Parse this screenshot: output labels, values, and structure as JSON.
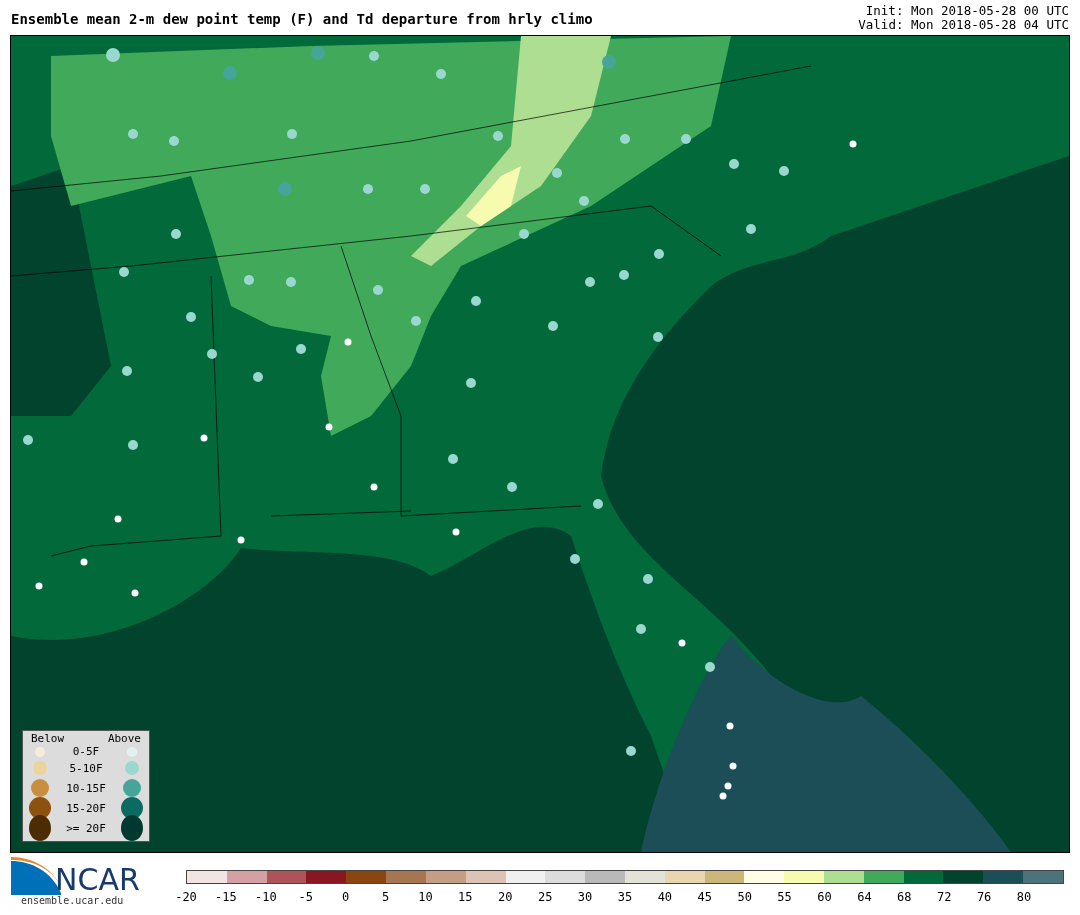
{
  "header": {
    "title": "Ensemble mean 2-m dew point temp (F) and Td departure from hrly climo",
    "init": "Init: Mon 2018-05-28 00 UTC",
    "valid": "Valid: Mon 2018-05-28 04 UTC"
  },
  "legend": {
    "below_label": "Below",
    "above_label": "Above",
    "rows": [
      {
        "label": "0-5F",
        "dots": [
          {
            "color": "#f7ecda"
          },
          {
            "color": "#e0f2ef"
          }
        ]
      },
      {
        "label": "5-10F",
        "dots": [
          {
            "color": "#ecd39b"
          },
          {
            "color": "#9ad8cf"
          }
        ]
      },
      {
        "label": "10-15F",
        "dots": [
          {
            "color": "#c88f40"
          },
          {
            "color": "#45a598"
          }
        ]
      },
      {
        "label": "15-20F",
        "dots": [
          {
            "color": "#8d520f"
          },
          {
            "color": "#0b6b62"
          }
        ]
      },
      {
        "label": ">= 20F",
        "dots": [
          {
            "color": "#4c2c04"
          },
          {
            "color": "#003a2e"
          }
        ]
      }
    ]
  },
  "footer": {
    "logo_text": "NCAR",
    "url": "ensemble.ucar.edu"
  },
  "colorbar": [
    {
      "tick": "-20",
      "color": "#f3e4e4"
    },
    {
      "tick": "-15",
      "color": "#d4a0a3"
    },
    {
      "tick": "-10",
      "color": "#ad5459"
    },
    {
      "tick": "-5",
      "color": "#8a1621"
    },
    {
      "tick": "0",
      "color": "#8a4511"
    },
    {
      "tick": "5",
      "color": "#a87552"
    },
    {
      "tick": "10",
      "color": "#c39e85"
    },
    {
      "tick": "15",
      "color": "#dcc3b3"
    },
    {
      "tick": "20",
      "color": "#f0f0f0"
    },
    {
      "tick": "25",
      "color": "#dcdcdc"
    },
    {
      "tick": "30",
      "color": "#b9b9b9"
    },
    {
      "tick": "35",
      "color": "#e2e2d6"
    },
    {
      "tick": "40",
      "color": "#e8d7ae"
    },
    {
      "tick": "45",
      "color": "#cdb67a"
    },
    {
      "tick": "50",
      "color": "#fffde3"
    },
    {
      "tick": "55",
      "color": "#f6fbaf"
    },
    {
      "tick": "60",
      "color": "#aede92"
    },
    {
      "tick": "64",
      "color": "#41aa5a"
    },
    {
      "tick": "68",
      "color": "#01693a"
    },
    {
      "tick": "72",
      "color": "#01432c"
    },
    {
      "tick": "76",
      "color": "#1b4e57"
    },
    {
      "tick": "80",
      "color": "#4a7479"
    }
  ]
}
